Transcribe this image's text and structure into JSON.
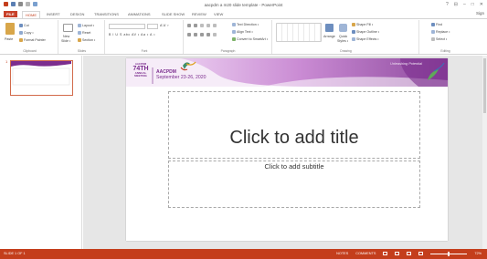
{
  "window": {
    "title": "aacpdm a m20 slide template - PowerPoint",
    "controls": [
      "?",
      "⊟",
      "–",
      "□",
      "✕"
    ],
    "signin": "Sign"
  },
  "tabs": [
    "FILE",
    "HOME",
    "INSERT",
    "DESIGN",
    "TRANSITIONS",
    "ANIMATIONS",
    "SLIDE SHOW",
    "REVIEW",
    "VIEW"
  ],
  "active_tab": "HOME",
  "ribbon": {
    "clipboard": {
      "label": "Clipboard",
      "paste": "Paste",
      "cut": "Cut",
      "copy": "Copy •",
      "format_painter": "Format Painter"
    },
    "slides": {
      "label": "Slides",
      "new_slide": "New",
      "new_slide2": "Slide •",
      "layout": "Layout •",
      "reset": "Reset",
      "section": "Section •"
    },
    "font": {
      "label": "Font",
      "row1": "A’ A’  ♀",
      "row2": "B I U S abc AV • Aa • A •"
    },
    "paragraph": {
      "label": "Paragraph",
      "text_direction": "Text Direction •",
      "align_text": "Align Text •",
      "smartart": "Convert to SmartArt •"
    },
    "drawing": {
      "label": "Drawing",
      "arrange": "Arrange",
      "quick_styles": "Quick",
      "quick_styles2": "Styles •",
      "shape_fill": "Shape Fill •",
      "shape_outline": "Shape Outline •",
      "shape_effects": "Shape Effects •"
    },
    "editing": {
      "label": "Editing",
      "find": "Find",
      "replace": "Replace •",
      "select": "Select •"
    }
  },
  "slide": {
    "number": "1",
    "banner": {
      "aacpdm_small": "AACPDM",
      "edition": "74TH",
      "annual": "ANNUAL",
      "meeting": "MEETING",
      "brand": "AACPDM",
      "dates": "September 23-26, 2020",
      "tagline": "Unleashing Potential"
    },
    "title_placeholder": "Click to add title",
    "subtitle_placeholder": "Click to add subtitle"
  },
  "statusbar": {
    "slide_info": "SLIDE 1 OF 1",
    "notes": "NOTES",
    "comments": "COMMENTS",
    "zoom": "72%"
  },
  "colors": {
    "accent": "#c43e1c",
    "banner_dark": "#7b2d8e",
    "banner_mid": "#b25cc2",
    "banner_light": "#e8c6ee",
    "banner_text_purple": "#7b2d8e"
  }
}
